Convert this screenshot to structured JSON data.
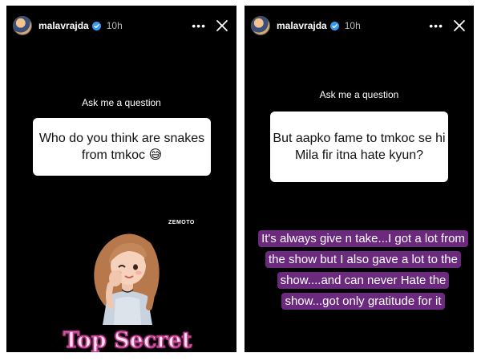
{
  "stories": [
    {
      "username": "malavrajda",
      "time": "10h",
      "more_label": "•••",
      "question_label": "Ask me a question",
      "question": "Who do you think are snakes from tmkoc 😅",
      "sticker_tag": "ZEMOTO",
      "sticker_text": "Top Secret"
    },
    {
      "username": "malavrajda",
      "time": "10h",
      "more_label": "•••",
      "question_label": "Ask me a question",
      "question": "But aapko fame to tmkoc se hi Mila fir itna hate kyun?",
      "answer": "It's always give n take...I got a lot from the show but I also gave a lot to the show....and can never Hate the show...got only gratitude for it"
    }
  ],
  "colors": {
    "story_bg": "#000000",
    "answer_highlight": "#6b2a7e",
    "verified": "#3897f0",
    "sticker_pink": "#c0428f"
  },
  "icons": [
    "verified-badge-icon",
    "more-icon",
    "close-icon"
  ]
}
